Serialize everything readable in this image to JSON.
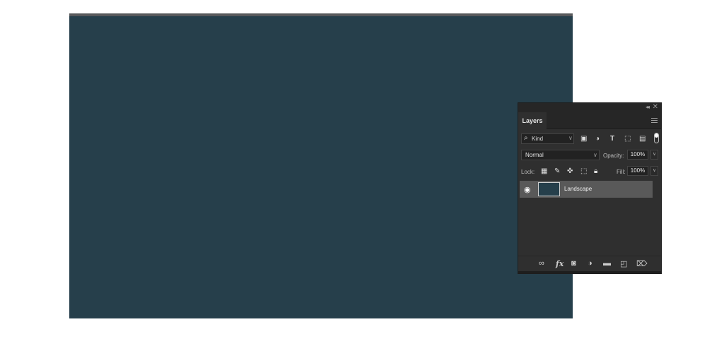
{
  "panel": {
    "tab_label": "Layers",
    "collapse_glyph": "◂◂",
    "close_glyph": "✕",
    "filter": {
      "kind_label": "Kind",
      "icons": [
        "image-filter-icon",
        "adjustment-filter-icon",
        "type-filter-icon",
        "shape-filter-icon",
        "smart-object-filter-icon"
      ]
    },
    "blend_mode": "Normal",
    "opacity_label": "Opacity:",
    "opacity_value": "100%",
    "lock_label": "Lock:",
    "fill_label": "Fill:",
    "fill_value": "100%",
    "layers": [
      {
        "name": "Landscape",
        "visible": true
      }
    ],
    "footer_icons": [
      "link-layers-icon",
      "fx-icon",
      "layer-mask-icon",
      "adjustment-layer-icon",
      "new-group-icon",
      "new-layer-icon",
      "delete-layer-icon"
    ]
  },
  "colors": {
    "document": "#263f4b",
    "panel_bg": "#2f2f2f",
    "selected_layer": "#595959"
  }
}
